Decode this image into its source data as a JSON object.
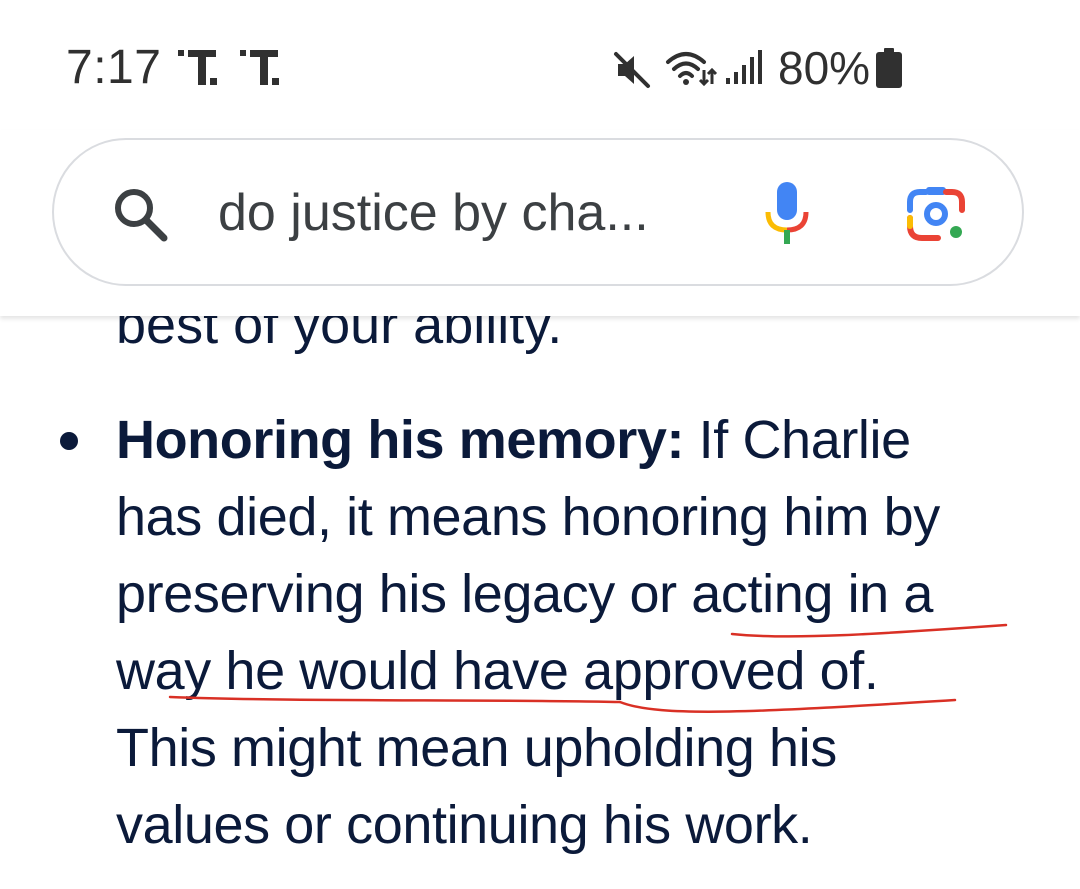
{
  "status_bar": {
    "time": "7:17",
    "battery_percent": "80%",
    "icons": [
      "notification-icon",
      "notification-icon",
      "mute-icon",
      "wifi-icon",
      "signal-icon",
      "battery-icon"
    ]
  },
  "search": {
    "query": "do justice by cha..."
  },
  "content": {
    "cut_line": "best of your ability.",
    "bullet_term": "Honoring his memory:",
    "lines": [
      " If Charlie",
      "has died, it means honoring him by",
      "preserving his legacy or acting in a",
      "way he would have approved of.",
      "This might mean upholding his",
      "values or continuing his work."
    ]
  },
  "annotation_color": "#d93025",
  "colors": {
    "text": "#0b1a3a",
    "google_blue": "#4285f4",
    "google_red": "#ea4335",
    "google_yellow": "#fbbc04",
    "google_green": "#34a853"
  }
}
